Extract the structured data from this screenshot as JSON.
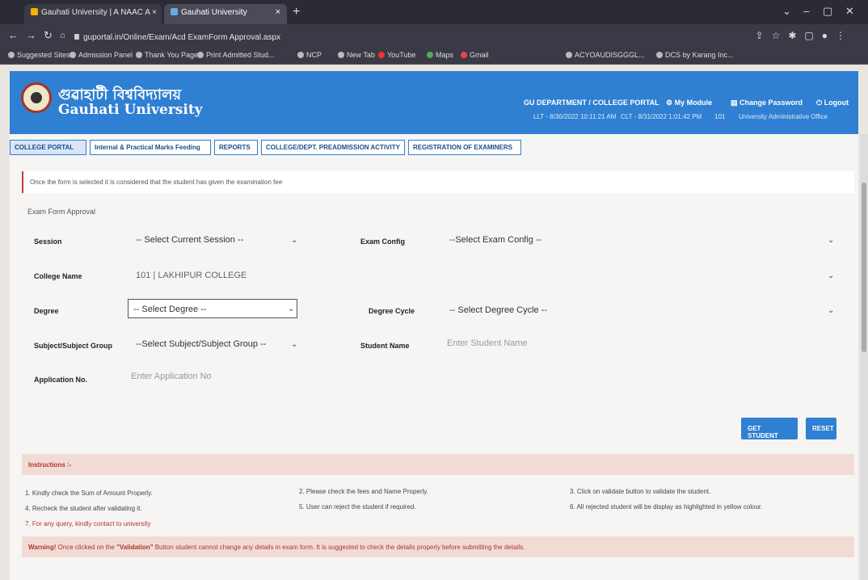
{
  "browser": {
    "tabs": [
      {
        "title": "Gauhati University | A NAAC A ×"
      },
      {
        "title": "Gauhati University"
      }
    ],
    "url": "guportal.in/Online/Exam/Acd ExamForm Approval.aspx",
    "bookmarks": [
      "Suggested Sites",
      "Admission Panel",
      "Thank You Page",
      "Print Admitted Stud...",
      "NCP",
      "New Tab",
      "YouTube",
      "Maps",
      "Gmail",
      "ACYOAUDISGGGL...",
      "DCS by Karang Inc..."
    ]
  },
  "header": {
    "brand_assamese": "গুৱাহাটী বিশ্ববিদ্যালয়",
    "brand_english": "Gauhati University",
    "portal_link": "GU DEPARTMENT / COLLEGE PORTAL",
    "my_module": "My Module",
    "change_password": "Change Password",
    "logout": "Logout",
    "last_login": "LLT - 8/30/2022 10:11:21 AM",
    "current_login": "CLT - 8/31/2022 1:01:42 PM",
    "college_code": "101",
    "office": "University Administrative Office"
  },
  "menu": {
    "items": [
      "COLLEGE PORTAL",
      "Internal & Practical Marks Feeding",
      "REPORTS",
      "COLLEGE/DEPT. PREADMISSION ACTIVITY",
      "REGISTRATION OF EXAMINERS"
    ]
  },
  "notice": "Once the form is selected it is considered that the student has given the examination fee",
  "section_title": "Exam Form Approval",
  "form": {
    "session_label": "Session",
    "session_value": "-- Select Current Session --",
    "exam_config_label": "Exam Config",
    "exam_config_value": "--Select Exam Config --",
    "college_label": "College Name",
    "college_value": "101 | LAKHIPUR COLLEGE",
    "degree_label": "Degree",
    "degree_value": "-- Select Degree --",
    "degree_cycle_label": "Degree Cycle",
    "degree_cycle_value": "-- Select Degree Cycle --",
    "subject_label": "Subject/Subject Group",
    "subject_value": "--Select Subject/Subject Group --",
    "student_name_label": "Student Name",
    "student_name_placeholder": "Enter Student Name",
    "application_label": "Application No.",
    "application_placeholder": "Enter Application No"
  },
  "buttons": {
    "get_student": "GET STUDENT",
    "reset": "RESET"
  },
  "instructions": {
    "title": "Instructions :-",
    "items": [
      "1. Kindly check the Sum of Amount Properly.",
      "2. Please check the fees and Name Properly.",
      "3. Click on validate button to validate the student.",
      "4. Recheck the student after validating it.",
      "5. User can reject the student if required.",
      "6. All rejected student will be display as highlighted in yellow colour.",
      "7. For any query, kindly contact to university"
    ]
  },
  "warning": {
    "prefix": "Warning!",
    "text_a": "Once clicked on the",
    "keyword": "\"Validation\"",
    "text_b": "Button student cannot change any details in exam form. It is suggested to check the details properly before submitting the details."
  }
}
